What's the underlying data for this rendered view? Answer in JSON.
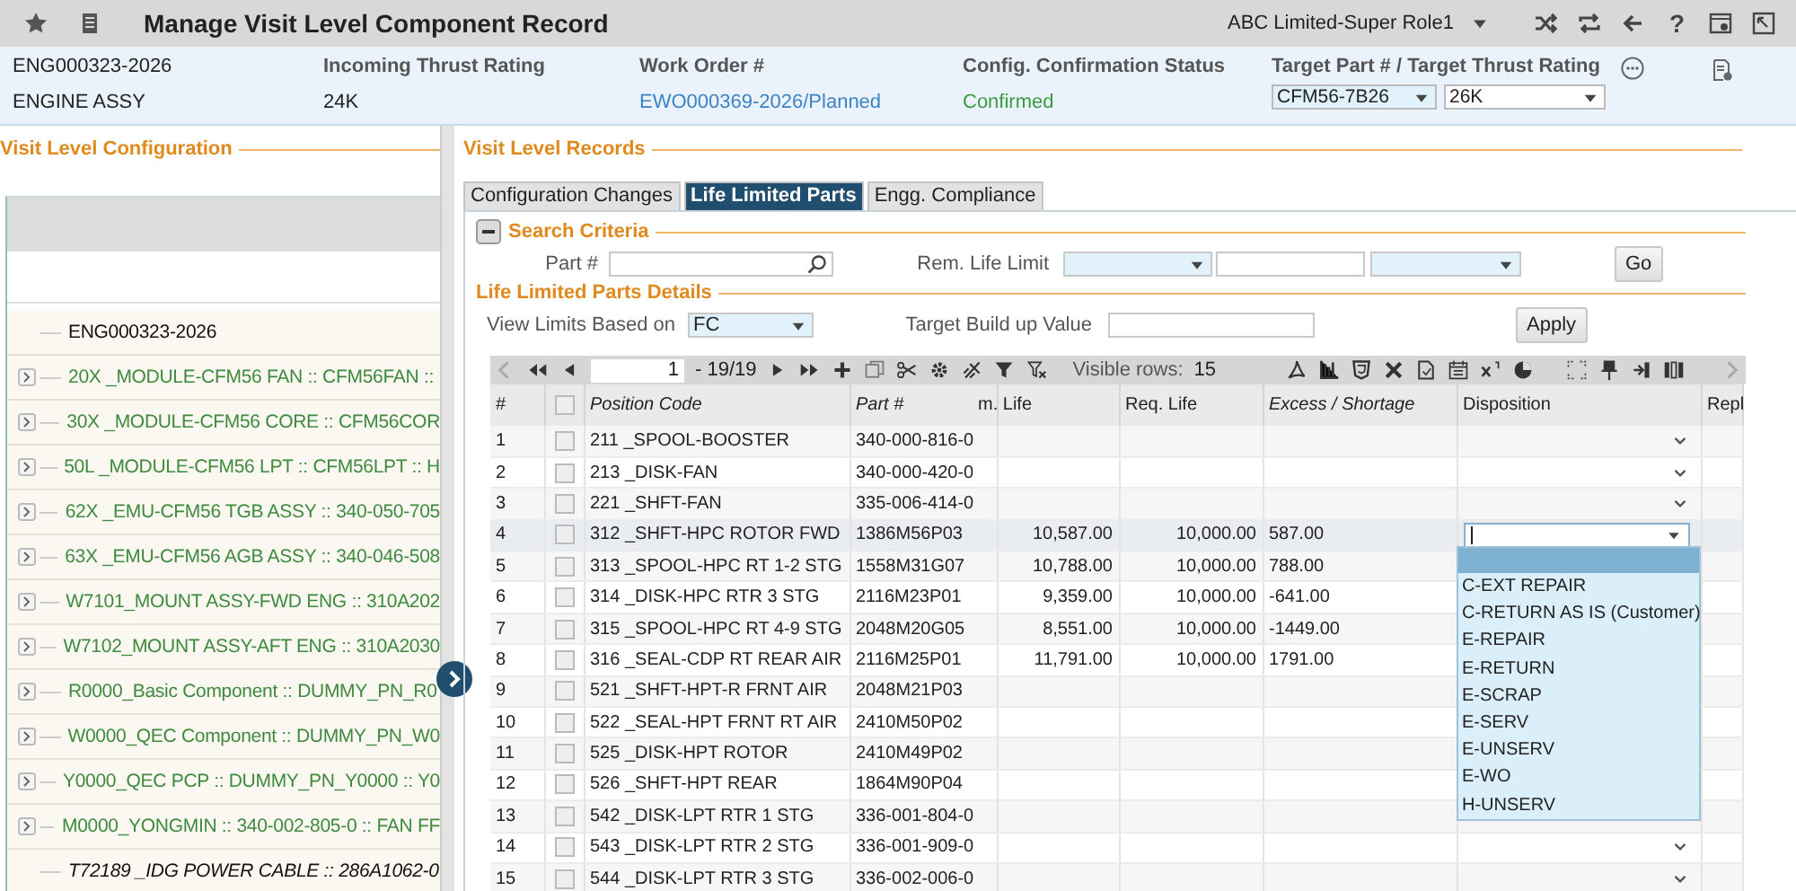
{
  "header": {
    "title": "Manage Visit Level Component Record",
    "role_selector": "ABC Limited-Super Role1",
    "help_button": "?"
  },
  "summary": {
    "component_number": "ENG000323-2026",
    "component_name": "ENGINE ASSY",
    "incoming_thrust_rating": {
      "label": "Incoming Thrust Rating",
      "value": "24K"
    },
    "work_order": {
      "label": "Work Order #",
      "value": "EWO000369-2026/Planned"
    },
    "config_status": {
      "label": "Config. Confirmation Status",
      "value": "Confirmed"
    },
    "target": {
      "label": "Target Part # / Target Thrust Rating",
      "part": "CFM56-7B26",
      "thrust": "26K"
    }
  },
  "configuration": {
    "title": "Visit Level Configuration",
    "tree": [
      {
        "label": "ENG000323-2026",
        "kind": "root",
        "expandable": false
      },
      {
        "label": "20X _MODULE-CFM56 FAN :: CFM56FAN ::",
        "kind": "module",
        "expandable": true
      },
      {
        "label": "30X _MODULE-CFM56 CORE :: CFM56COR",
        "kind": "module",
        "expandable": true
      },
      {
        "label": "50L _MODULE-CFM56 LPT :: CFM56LPT :: H",
        "kind": "module",
        "expandable": true
      },
      {
        "label": "62X _EMU-CFM56 TGB ASSY :: 340-050-705",
        "kind": "module",
        "expandable": true
      },
      {
        "label": "63X _EMU-CFM56 AGB ASSY :: 340-046-508",
        "kind": "module",
        "expandable": true
      },
      {
        "label": "W7101_MOUNT ASSY-FWD ENG :: 310A202",
        "kind": "module",
        "expandable": true
      },
      {
        "label": "W7102_MOUNT ASSY-AFT ENG :: 310A2030",
        "kind": "module",
        "expandable": true
      },
      {
        "label": "R0000_Basic Component :: DUMMY_PN_R0",
        "kind": "module",
        "expandable": true
      },
      {
        "label": "W0000_QEC Component :: DUMMY_PN_W0",
        "kind": "module",
        "expandable": true
      },
      {
        "label": "Y0000_QEC PCP :: DUMMY_PN_Y0000 :: Y0",
        "kind": "module",
        "expandable": true
      },
      {
        "label": "M0000_YONGMIN :: 340-002-805-0 :: FAN FF",
        "kind": "module",
        "expandable": true
      },
      {
        "label": "T72189 _IDG POWER CABLE :: 286A1062-0",
        "kind": "item",
        "expandable": false
      }
    ]
  },
  "records": {
    "title": "Visit Level Records",
    "tabs": [
      {
        "label": "Configuration Changes",
        "selected": false
      },
      {
        "label": "Life Limited Parts",
        "selected": true
      },
      {
        "label": "Engg. Compliance",
        "selected": false
      }
    ],
    "search": {
      "title": "Search Criteria",
      "expanded": true,
      "part_label": "Part #",
      "rem_life_label": "Rem. Life Limit",
      "go_button": "Go"
    },
    "details": {
      "title": "Life Limited Parts Details",
      "view_limits_label": "View Limits Based on",
      "view_limits_value": "FC",
      "target_label": "Target Build up Value",
      "apply_button": "Apply"
    },
    "pager": {
      "page": "1",
      "page_count": "- 19/19",
      "visible_rows_label": "Visible rows:",
      "visible_rows": "15"
    },
    "table": {
      "columns": [
        {
          "kind": "text",
          "label": "#",
          "italic": false
        },
        {
          "kind": "checkbox",
          "checked": false
        },
        {
          "kind": "text",
          "label": "Position Code",
          "italic": true
        },
        {
          "kind": "text",
          "label": "Part #",
          "italic": true
        },
        {
          "kind": "text",
          "label": "m. Life",
          "italic": false
        },
        {
          "kind": "text",
          "label": "Req. Life",
          "italic": false
        },
        {
          "kind": "text",
          "label": "Excess / Shortage",
          "italic": true
        },
        {
          "kind": "text",
          "label": "Disposition",
          "italic": false
        },
        {
          "kind": "text",
          "label": "Repl",
          "italic": false
        }
      ],
      "rows": [
        {
          "number": "1",
          "checked": false,
          "position_code": "211 _SPOOL-BOOSTER",
          "part": "340-000-816-0",
          "disposition": {
            "kind": "chevron"
          },
          "selected": false
        },
        {
          "number": "2",
          "checked": false,
          "position_code": "213 _DISK-FAN",
          "part": "340-000-420-0",
          "disposition": {
            "kind": "chevron"
          },
          "selected": false
        },
        {
          "number": "3",
          "checked": false,
          "position_code": "221 _SHFT-FAN",
          "part": "335-006-414-0",
          "disposition": {
            "kind": "chevron"
          },
          "selected": false
        },
        {
          "number": "4",
          "checked": false,
          "position_code": "312 _SHFT-HPC ROTOR FWD",
          "part": "1386M56P03",
          "rem_life": "10,587.00",
          "req_life": "10,000.00",
          "excess": "587.00",
          "disposition": {
            "kind": "input"
          },
          "selected": true
        },
        {
          "number": "5",
          "checked": false,
          "position_code": "313 _SPOOL-HPC RT 1-2 STG",
          "part": "1558M31G07",
          "rem_life": "10,788.00",
          "req_life": "10,000.00",
          "excess": "788.00",
          "selected": false
        },
        {
          "number": "6",
          "checked": false,
          "position_code": "314 _DISK-HPC RTR 3 STG",
          "part": "2116M23P01",
          "rem_life": "9,359.00",
          "req_life": "10,000.00",
          "excess": "-641.00",
          "selected": false
        },
        {
          "number": "7",
          "checked": false,
          "position_code": "315 _SPOOL-HPC RT 4-9 STG",
          "part": "2048M20G05",
          "rem_life": "8,551.00",
          "req_life": "10,000.00",
          "excess": "-1449.00",
          "selected": false
        },
        {
          "number": "8",
          "checked": false,
          "position_code": "316 _SEAL-CDP RT REAR AIR",
          "part": "2116M25P01",
          "rem_life": "11,791.00",
          "req_life": "10,000.00",
          "excess": "1791.00",
          "selected": false
        },
        {
          "number": "9",
          "checked": false,
          "position_code": "521 _SHFT-HPT-R FRNT AIR",
          "part": "2048M21P03",
          "selected": false
        },
        {
          "number": "10",
          "checked": false,
          "position_code": "522 _SEAL-HPT FRNT RT AIR",
          "part": "2410M50P02",
          "selected": false
        },
        {
          "number": "11",
          "checked": false,
          "position_code": "525 _DISK-HPT ROTOR",
          "part": "2410M49P02",
          "selected": false
        },
        {
          "number": "12",
          "checked": false,
          "position_code": "526 _SHFT-HPT REAR",
          "part": "1864M90P04",
          "selected": false
        },
        {
          "number": "13",
          "checked": false,
          "position_code": "542 _DISK-LPT RTR 1 STG",
          "part": "336-001-804-0",
          "selected": false
        },
        {
          "number": "14",
          "checked": false,
          "position_code": "543 _DISK-LPT RTR 2 STG",
          "part": "336-001-909-0",
          "disposition": {
            "kind": "chevron"
          },
          "selected": false
        },
        {
          "number": "15",
          "checked": false,
          "position_code": "544 _DISK-LPT RTR 3 STG",
          "part": "336-002-006-0",
          "disposition": {
            "kind": "chevron"
          },
          "selected": false
        }
      ]
    },
    "disposition_dropdown": {
      "blank_option_highlighted": true,
      "options": [
        "C-EXT REPAIR",
        "C-RETURN AS IS (Customer)",
        "E-REPAIR",
        "E-RETURN",
        "E-SCRAP",
        "E-SERV",
        "E-UNSERV",
        "E-WO",
        "H-UNSERV"
      ]
    }
  }
}
